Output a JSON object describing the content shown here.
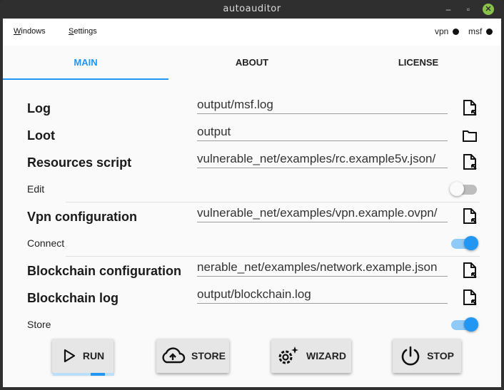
{
  "window": {
    "title": "autoauditor"
  },
  "menu": {
    "windows": "Windows",
    "windows_u": "W",
    "windows_rest": "indows",
    "settings": "Settings",
    "settings_u": "S",
    "settings_rest": "ettings"
  },
  "status": {
    "vpn": "vpn",
    "msf": "msf"
  },
  "tabs": [
    {
      "label": "MAIN",
      "active": true
    },
    {
      "label": "ABOUT"
    },
    {
      "label": "LICENSE"
    }
  ],
  "form": {
    "log": {
      "label": "Log",
      "value": "output/msf.log"
    },
    "loot": {
      "label": "Loot",
      "value": "output"
    },
    "resources": {
      "label": "Resources script",
      "value": "/vulnerable_net/examples/rc.example5v.json"
    },
    "edit": {
      "label": "Edit",
      "state": "off"
    },
    "vpn": {
      "label": "Vpn configuration",
      "value": "/vulnerable_net/examples/vpn.example.ovpn"
    },
    "connect": {
      "label": "Connect",
      "state": "on"
    },
    "blockchain_cfg": {
      "label": "Blockchain configuration",
      "value": "nerable_net/examples/network.example.json"
    },
    "blockchain_log": {
      "label": "Blockchain log",
      "value": "output/blockchain.log"
    },
    "store": {
      "label": "Store",
      "state": "on"
    }
  },
  "buttons": {
    "run": "RUN",
    "store": "STORE",
    "wizard": "WIZARD",
    "stop": "STOP"
  },
  "run_progress": 0.25,
  "colors": {
    "accent": "#2196f3",
    "accent_light": "#90caf9"
  }
}
